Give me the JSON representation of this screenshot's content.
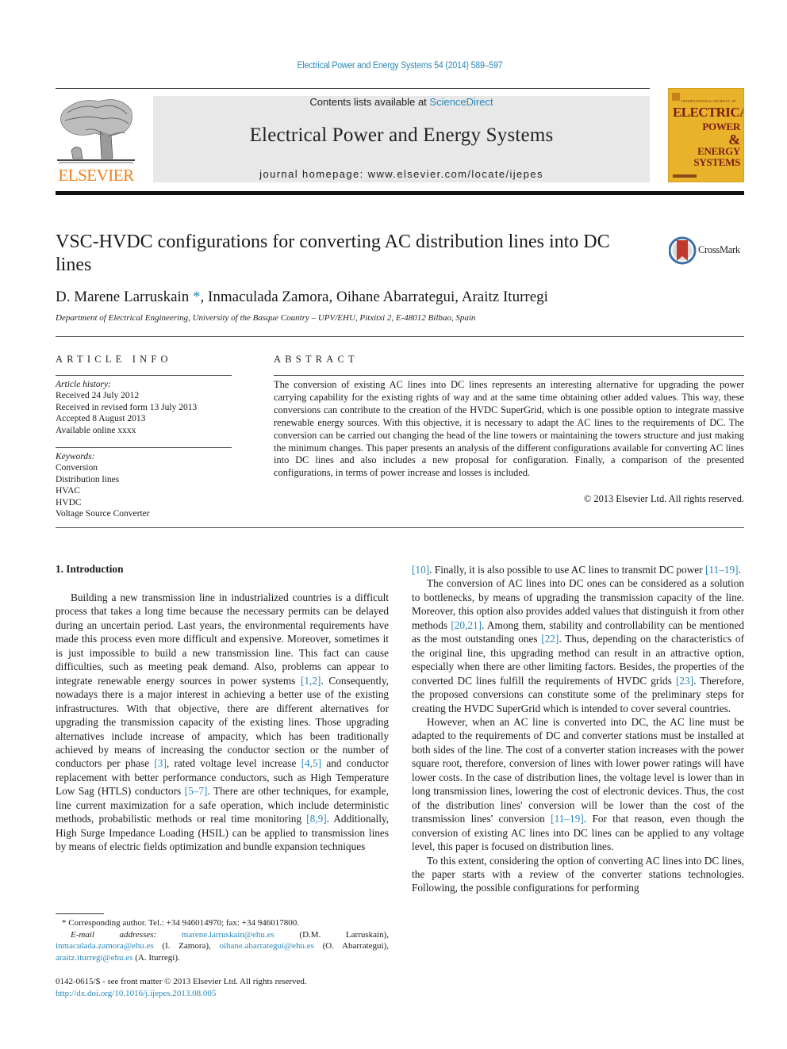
{
  "header": {
    "citation": "Electrical Power and Energy Systems 54 (2014) 589–597",
    "contents_prefix": "Contents lists available at ",
    "contents_link": "ScienceDirect",
    "journal_name": "Electrical Power and Energy Systems",
    "homepage": "journal homepage: www.elsevier.com/locate/ijepes",
    "publisher_logo_text": "ELSEVIER",
    "cover": {
      "intl": "INTERNATIONAL JOURNAL OF",
      "line1": "ELECTRICAL",
      "line2": "POWER",
      "line3": "&",
      "line4": "ENERGY",
      "line5": "SYSTEMS"
    },
    "crossmark_label": "CrossMark",
    "colors": {
      "link": "#2a88b8",
      "elsevier_orange": "#f07f1c",
      "cover_yellow": "#e9b22b",
      "cover_red": "#7a1e12",
      "masthead_gray": "#e8e8e8"
    }
  },
  "article": {
    "title": "VSC-HVDC configurations for converting AC distribution lines into DC lines",
    "authors": "D. Marene Larruskain",
    "corresponding_mark": "*",
    "authors_rest": ", Inmaculada Zamora, Oihane Abarrategui, Araitz Iturregi",
    "affiliation": "Department of Electrical Engineering, University of the Basque Country – UPV/EHU, Pitxitxi 2, E-48012 Bilbao, Spain"
  },
  "article_info": {
    "heading": "ARTICLE INFO",
    "history_label": "Article history:",
    "history": [
      "Received 24 July 2012",
      "Received in revised form 13 July 2013",
      "Accepted 8 August 2013",
      "Available online xxxx"
    ],
    "keywords_label": "Keywords:",
    "keywords": [
      "Conversion",
      "Distribution lines",
      "HVAC",
      "HVDC",
      "Voltage Source Converter"
    ]
  },
  "abstract": {
    "heading": "ABSTRACT",
    "text": "The conversion of existing AC lines into DC lines represents an interesting alternative for upgrading the power carrying capability for the existing rights of way and at the same time obtaining other added values. This way, these conversions can contribute to the creation of the HVDC SuperGrid, which is one possible option to integrate massive renewable energy sources. With this objective, it is necessary to adapt the AC lines to the requirements of DC. The conversion can be carried out changing the head of the line towers or maintaining the towers structure and just making the minimum changes. This paper presents an analysis of the different configurations available for converting AC lines into DC lines and also includes a new proposal for configuration. Finally, a comparison of the presented configurations, in terms of power increase and losses is included.",
    "copyright": "© 2013 Elsevier Ltd. All rights reserved."
  },
  "body": {
    "section_heading": "1. Introduction",
    "left_p1": [
      {
        "t": "Building a new transmission line in industrialized countries is a difficult process that takes a long time because the necessary permits can be delayed during an uncertain period. Last years, the environmental requirements have made this process even more difficult and expensive. Moreover, sometimes it is just impossible to build a new transmission line. This fact can cause difficulties, such as meeting peak demand. Also, problems can appear to integrate renewable energy sources in power systems "
      },
      {
        "ref": "[1,2]"
      },
      {
        "t": ". Consequently, nowadays there is a major interest in achieving a better use of the existing infrastructures. With that objective, there are different alternatives for upgrading the transmission capacity of the existing lines. Those upgrading alternatives include increase of ampacity, which has been traditionally achieved by means of increasing the conductor section or the number of conductors per phase "
      },
      {
        "ref": "[3]"
      },
      {
        "t": ", rated voltage level increase "
      },
      {
        "ref": "[4,5]"
      },
      {
        "t": " and conductor replacement with better performance conductors, such as High Temperature Low Sag (HTLS) conductors "
      },
      {
        "ref": "[5–7]"
      },
      {
        "t": ". There are other techniques, for example, line current maximization for a safe operation, which include deterministic methods, probabilistic methods or real time monitoring "
      },
      {
        "ref": "[8,9]"
      },
      {
        "t": ". Additionally, High Surge Impedance Loading (HSIL) can be applied to transmission lines by means of electric fields optimization and bundle expansion techniques"
      }
    ],
    "right_p0": [
      {
        "ref": "[10]"
      },
      {
        "t": ". Finally, it is also possible to use AC lines to transmit DC power "
      },
      {
        "ref": "[11–19]"
      },
      {
        "t": "."
      }
    ],
    "right_p1": [
      {
        "t": "The conversion of AC lines into DC ones can be considered as a solution to bottlenecks, by means of upgrading the transmission capacity of the line. Moreover, this option also provides added values that distinguish it from other methods "
      },
      {
        "ref": "[20,21]"
      },
      {
        "t": ". Among them, stability and controllability can be mentioned as the most outstanding ones "
      },
      {
        "ref": "[22]"
      },
      {
        "t": ". Thus, depending on the characteristics of the original line, this upgrading method can result in an attractive option, especially when there are other limiting factors. Besides, the properties of the converted DC lines fulfill the requirements of HVDC grids "
      },
      {
        "ref": "[23]"
      },
      {
        "t": ". Therefore, the proposed conversions can constitute some of the preliminary steps for creating the HVDC SuperGrid which is intended to cover several countries."
      }
    ],
    "right_p2": [
      {
        "t": "However, when an AC line is converted into DC, the AC line must be adapted to the requirements of DC and converter stations must be installed at both sides of the line. The cost of a converter station increases with the power square root, therefore, conversion of lines with lower power ratings will have lower costs. In the case of distribution lines, the voltage level is lower than in long transmission lines, lowering the cost of electronic devices. Thus, the cost of the distribution lines' conversion will be lower than the cost of the transmission lines' conversion "
      },
      {
        "ref": "[11–19]"
      },
      {
        "t": ". For that reason, even though the conversion of existing AC lines into DC lines can be applied to any voltage level, this paper is focused on distribution lines."
      }
    ],
    "right_p3": [
      {
        "t": "To this extent, considering the option of converting AC lines into DC lines, the paper starts with a review of the converter stations technologies. Following, the possible configurations for performing"
      }
    ]
  },
  "footnotes": {
    "corresponding": "* Corresponding author. Tel.: +34 946014970; fax: +34 946017800.",
    "email_label": "E-mail addresses:",
    "emails": [
      {
        "addr": "marene.larruskain@ehu.es",
        "name": " (D.M. Larruskain), "
      },
      {
        "addr": "inmaculada.zamora@ehu.es",
        "name": " (I. Zamora), "
      },
      {
        "addr": "oihane.abarrategui@ehu.es",
        "name": " (O. Abarrategui), "
      },
      {
        "addr": "araitz.iturregi@ehu.es",
        "name": " (A. Iturregi)."
      }
    ],
    "front_matter": "0142-0615/$ - see front matter © 2013 Elsevier Ltd. All rights reserved.",
    "doi": "http://dx.doi.org/10.1016/j.ijepes.2013.08.005"
  }
}
